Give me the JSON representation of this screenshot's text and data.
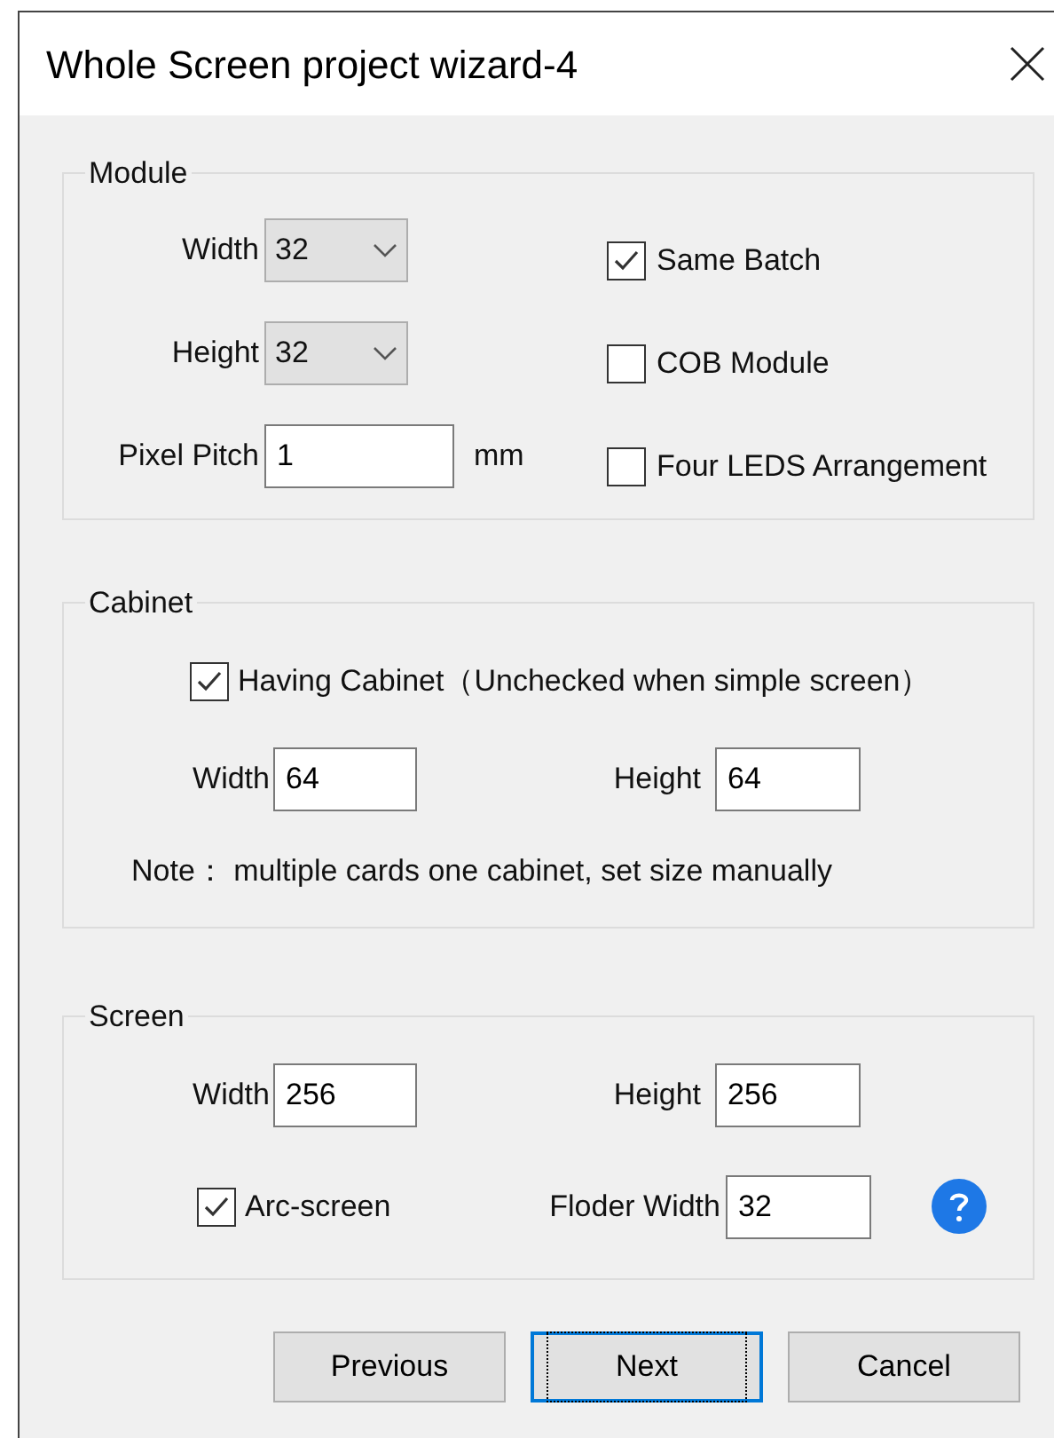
{
  "window": {
    "title": "Whole Screen project wizard-4"
  },
  "module": {
    "title": "Module",
    "fields": [
      {
        "kind": "dropdown",
        "label": "Width",
        "value": "32"
      },
      {
        "kind": "dropdown",
        "label": "Height",
        "value": "32"
      },
      {
        "kind": "input",
        "label": "Pixel Pitch",
        "value": "1",
        "unit": "mm"
      }
    ],
    "options": [
      {
        "label": "Same Batch",
        "checked": true
      },
      {
        "label": "COB Module",
        "checked": false
      },
      {
        "label": "Four LEDS Arrangement",
        "checked": false
      }
    ]
  },
  "cabinet": {
    "title": "Cabinet",
    "having_cabinet": {
      "label": "Having Cabinet（Unchecked when simple screen）",
      "checked": true
    },
    "fields": [
      {
        "label": "Width",
        "value": "64"
      },
      {
        "label": "Height",
        "value": "64"
      }
    ],
    "note": "Note： multiple cards one cabinet, set size manually"
  },
  "screen": {
    "title": "Screen",
    "fields": [
      {
        "label": "Width",
        "value": "256"
      },
      {
        "label": "Height",
        "value": "256"
      }
    ],
    "arc_screen": {
      "label": "Arc-screen",
      "checked": true
    },
    "floder_width": {
      "label": "Floder Width",
      "value": "32"
    }
  },
  "buttons": [
    {
      "label": "Previous",
      "focused": false
    },
    {
      "label": "Next",
      "focused": true
    },
    {
      "label": "Cancel",
      "focused": false
    }
  ]
}
